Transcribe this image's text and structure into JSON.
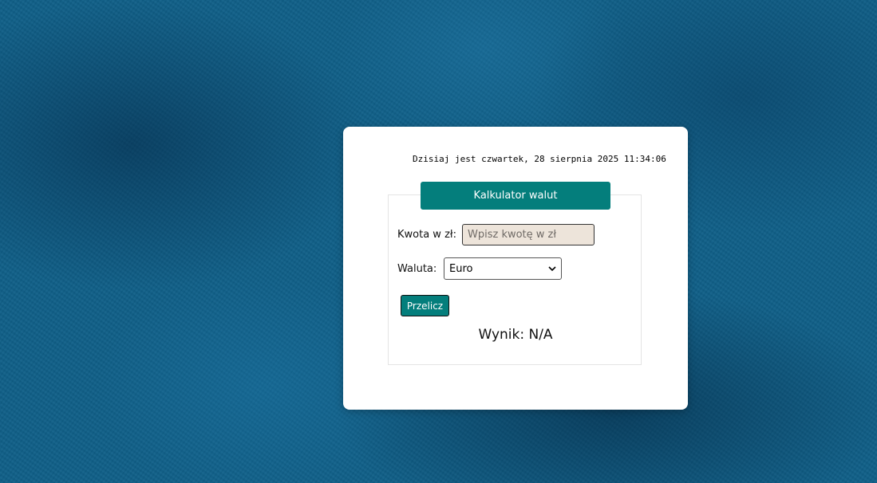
{
  "header": {
    "datetime": "Dzisiaj jest czwartek, 28 sierpnia 2025 11:34:06"
  },
  "calculator": {
    "title": "Kalkulator walut",
    "amount_label": "Kwota w zł:",
    "amount_value": "",
    "amount_placeholder": "Wpisz kwotę w zł",
    "currency_label": "Waluta:",
    "currency_selected": "Euro",
    "convert_label": "Przelicz",
    "result_text": "Wynik: N/A"
  },
  "colors": {
    "accent": "#047e7c",
    "background": "#0f5f88",
    "input_bg": "#ede4da"
  }
}
